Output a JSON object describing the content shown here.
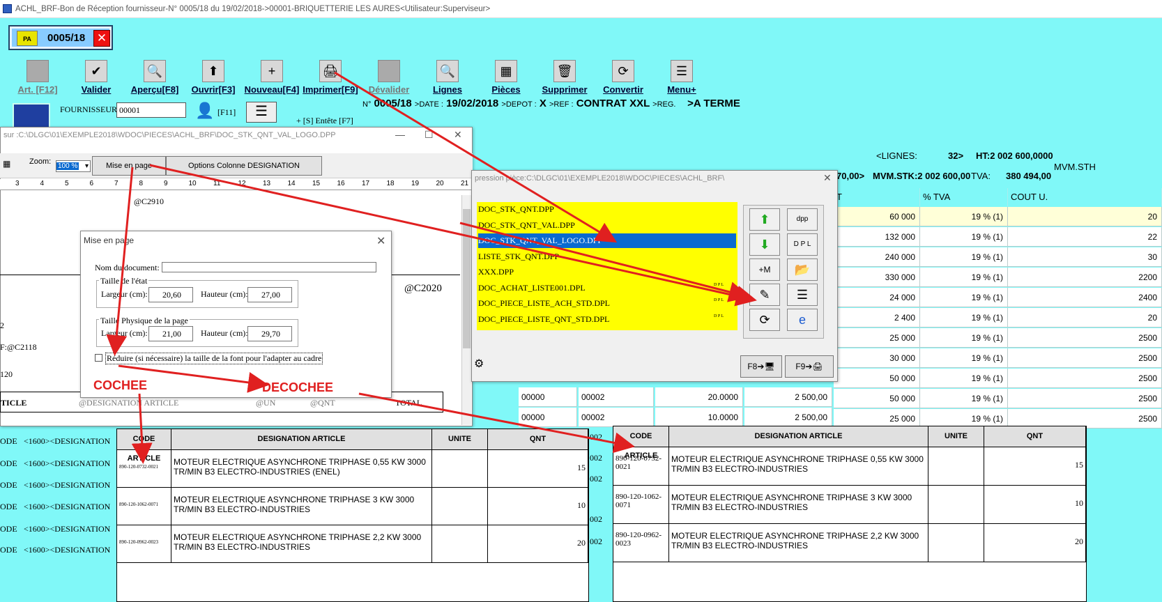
{
  "window": {
    "title": "ACHL_BRF-Bon de Réception fournisseur-N° 0005/18 du 19/02/2018->00001-BRIQUETTERIE LES AURES<Utilisateur:Superviseur>"
  },
  "doc": {
    "number": "0005/18",
    "icon_text": "PA"
  },
  "toolbar": [
    {
      "label": "Art. [F12]",
      "icon": "article-icon",
      "enabled": false
    },
    {
      "label": "Valider",
      "icon": "checkmark-icon",
      "enabled": true
    },
    {
      "label": "Aperçu[F8]",
      "icon": "preview-icon",
      "enabled": true
    },
    {
      "label": "Ouvrir[F3]",
      "icon": "open-icon",
      "enabled": true
    },
    {
      "label": "Nouveau[F4]",
      "icon": "new-icon",
      "enabled": true
    },
    {
      "label": "Imprimer[F9]",
      "icon": "printer-icon",
      "enabled": true
    },
    {
      "label": "Dévalider",
      "icon": "unvalidate-icon",
      "enabled": false
    },
    {
      "label": "Lignes",
      "icon": "search-icon",
      "enabled": true
    },
    {
      "label": "Pièces",
      "icon": "grid-icon",
      "enabled": true
    },
    {
      "label": "Supprimer",
      "icon": "trash-icon",
      "enabled": true
    },
    {
      "label": "Convertir",
      "icon": "convert-icon",
      "enabled": true
    },
    {
      "label": "Menu+",
      "icon": "menu-icon",
      "enabled": true
    }
  ],
  "fournisseur": {
    "label": "FOURNISSEUR:",
    "value": "00001",
    "f11": "[F11]",
    "entete": "[S] Entête [F7]"
  },
  "header": {
    "num_lbl": "N°",
    "num": "0005/18",
    "date_lbl": ">DATE :",
    "date": "19/02/2018",
    "depot_lbl": ">DEPOT :",
    "depot": "X",
    "ref_lbl": ">REF :",
    "ref": "CONTRAT XXL",
    "reg_lbl": ">REG.",
    "reg": ">A TERME"
  },
  "totals": {
    "lignes_lbl": "<LIGNES:",
    "lignes": "32>",
    "ht": "HT:2 002 600,0000",
    "t70": "70,00>",
    "mvm": "MVM.STK:2 002 600,00",
    "tva_lbl": "TVA:",
    "tva": "380 494,00",
    "mvmsth": "MVM.STH"
  },
  "grid": {
    "headers": [
      "T",
      "% TVA",
      "COUT U."
    ],
    "rows": [
      [
        "60 000",
        "19 % (1)",
        "20"
      ],
      [
        "132 000",
        "19 % (1)",
        "22"
      ],
      [
        "240 000",
        "19 % (1)",
        "30"
      ],
      [
        "330 000",
        "19 % (1)",
        "2200"
      ],
      [
        "24 000",
        "19 % (1)",
        "2400"
      ],
      [
        "2 400",
        "19 % (1)",
        "20"
      ],
      [
        "25 000",
        "19 % (1)",
        "2500"
      ],
      [
        "30 000",
        "19 % (1)",
        "2500"
      ],
      [
        "50 000",
        "19 % (1)",
        "2500"
      ],
      [
        "50 000",
        "19 % (1)",
        "2500"
      ],
      [
        "25 000",
        "19 % (1)",
        "2500"
      ]
    ],
    "extra_rows": [
      [
        "00000",
        "00002",
        "20.0000",
        "2 500,00"
      ],
      [
        "00000",
        "00002",
        "10.0000",
        "2 500,00"
      ]
    ]
  },
  "editor": {
    "title": "sur :C:\\DLGC\\01\\EXEMPLE2018\\WDOC\\PIECES\\ACHL_BRF\\DOC_STK_QNT_VAL_LOGO.DPP",
    "zoom_lbl": "Zoom:",
    "zoom": "100 %",
    "btn_mise": "Mise en page",
    "btn_options": "Options Colonne DESIGNATION",
    "ruler": [
      "3",
      "4",
      "5",
      "6",
      "7",
      "8",
      "9",
      "10",
      "11",
      "12",
      "13",
      "14",
      "15",
      "16",
      "17",
      "18",
      "19",
      "20",
      "21"
    ],
    "c2910": "@C2910",
    "c2020": "@C2020",
    "n2": "2",
    "fc2118": "F:@C2118",
    "n120": "120",
    "ticle": "TICLE",
    "desart": "@DESIGNATION ARTICLE",
    "un": "@UN",
    "qntcol": "@QNT",
    "total": "TOTAL",
    "ode": "ODE",
    "desig": "<1600><DESIGNATION"
  },
  "print": {
    "title": "pression pièce:C:\\DLGC\\01\\EXEMPLE2018\\WDOC\\PIECES\\ACHL_BRF\\",
    "items": [
      "DOC_STK_QNT.DPP",
      "DOC_STK_QNT_VAL.DPP",
      "DOC_STK_QNT_VAL_LOGO.DPP",
      "LISTE_STK_QNT.DPP",
      "XXX.DPP",
      "DOC_ACHAT_LISTE001.DPL",
      "DOC_PIECE_LISTE_ACH_STD.DPL",
      "DOC_PIECE_LISTE_QNT_STD.DPL"
    ],
    "selected": 2,
    "f8": "F8",
    "f9": "F9",
    "plus_m": "+M",
    "dpl": "D P L"
  },
  "dialog": {
    "title": "Mise en page",
    "nom_lbl": "Nom du document:",
    "taille_etat": "Taille de l'état",
    "largeur_lbl": "Largeur (cm):",
    "hauteur_lbl": "Hauteur (cm):",
    "etat_largeur": "20,60",
    "etat_hauteur": "27,00",
    "taille_phys": "Taille Physique de la page",
    "phys_largeur": "21,00",
    "phys_hauteur": "29,70",
    "reduire": "Réduire (si nécessaire) la taille de la font pour l'adapter au cadre"
  },
  "annotations": {
    "cochee": "COCHEE",
    "decochee": "DECOCHEE"
  },
  "table_left": {
    "headers": [
      "CODE ARTICLE",
      "DESIGNATION ARTICLE",
      "UNITE",
      "QNT"
    ],
    "rows": [
      [
        "890-120-0732-0021",
        "MOTEUR ELECTRIQUE ASYNCHRONE TRIPHASE 0,55 KW 3000 TR/MIN B3 ELECTRO-INDUSTRIES (ENEL)",
        "",
        "15"
      ],
      [
        "890-120-1062-0071",
        "MOTEUR ELECTRIQUE ASYNCHRONE TRIPHASE 3 KW 3000 TR/MIN B3 ELECTRO-INDUSTRIES",
        "",
        "10"
      ],
      [
        "890-120-0962-0023",
        "MOTEUR ELECTRIQUE ASYNCHRONE TRIPHASE 2,2 KW 3000 TR/MIN B3 ELECTRO-INDUSTRIES",
        "",
        "20"
      ]
    ]
  },
  "table_right": {
    "headers": [
      "CODE ARTICLE",
      "DESIGNATION ARTICLE",
      "UNITE",
      "QNT"
    ],
    "rows": [
      [
        "890-120-0732-0021",
        "MOTEUR ELECTRIQUE ASYNCHRONE TRIPHASE 0,55 KW 3000 TR/MIN B3 ELECTRO-INDUSTRIES",
        "",
        "15"
      ],
      [
        "890-120-1062-0071",
        "MOTEUR ELECTRIQUE ASYNCHRONE TRIPHASE 3 KW 3000 TR/MIN B3 ELECTRO-INDUSTRIES",
        "",
        "10"
      ],
      [
        "890-120-0962-0023",
        "MOTEUR ELECTRIQUE ASYNCHRONE TRIPHASE 2,2 KW 3000 TR/MIN B3 ELECTRO-INDUSTRIES",
        "",
        "20"
      ]
    ]
  },
  "gridcol": {
    "n002": "002"
  },
  "colors": {
    "cyan": "#80f8f8",
    "yellow": "#ffff00",
    "select": "#0a6ad0",
    "annotation": "#e02020"
  }
}
